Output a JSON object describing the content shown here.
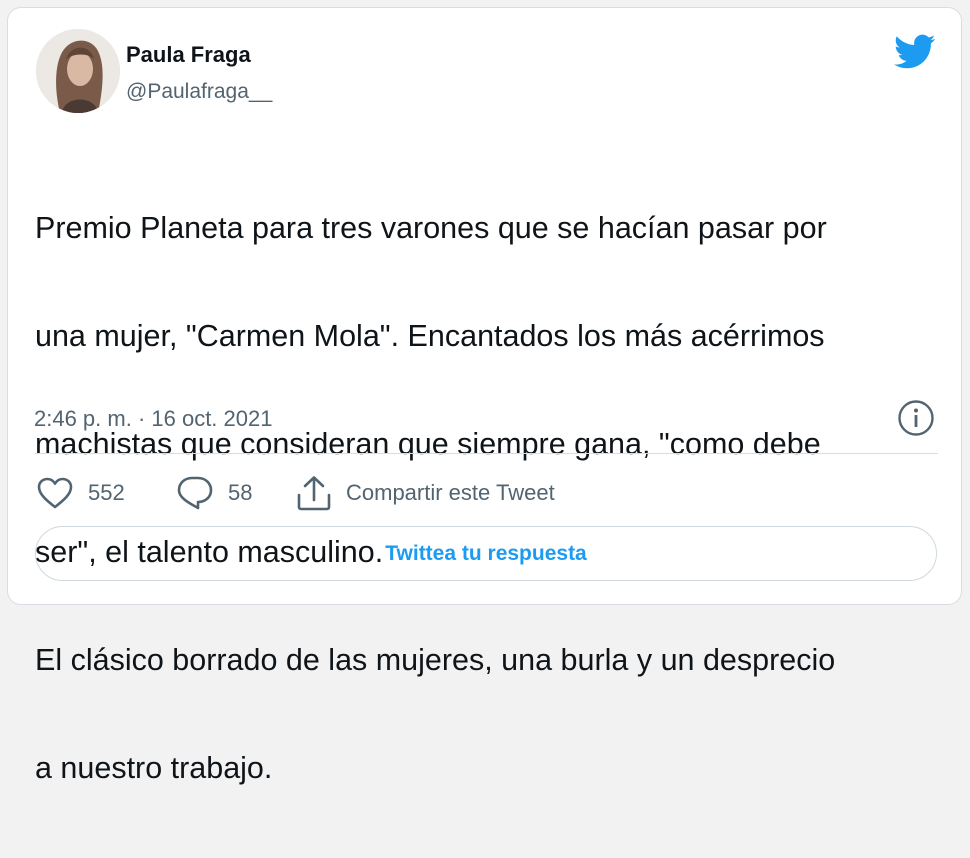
{
  "author": {
    "name": "Paula Fraga",
    "handle": "@Paulafraga__"
  },
  "tweet": {
    "lines": [
      "Premio Planeta para tres varones que se hacían pasar por",
      "una mujer, \"Carmen Mola\". Encantados los más acérrimos",
      "machistas que consideran que siempre gana, \"como debe",
      "ser\", el talento masculino.",
      "El clásico borrado de las mujeres, una burla y un desprecio",
      "a nuestro trabajo."
    ],
    "timestamp": "2:46 p. m. · 16 oct. 2021"
  },
  "actions": {
    "likes": "552",
    "replies": "58",
    "share_label": "Compartir este Tweet"
  },
  "reply_button": {
    "label": "Twittea tu respuesta"
  },
  "colors": {
    "accent": "#1d9bf0",
    "secondary_text": "#536471",
    "border": "#cfd9de"
  },
  "icons": [
    "twitter-bird-icon",
    "info-icon",
    "heart-icon",
    "reply-bubble-icon",
    "share-icon"
  ]
}
